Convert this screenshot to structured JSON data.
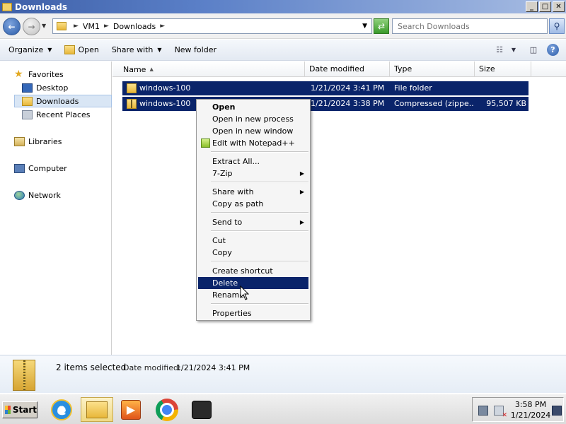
{
  "window": {
    "title": "Downloads",
    "controls": [
      "_",
      "□",
      "✕"
    ]
  },
  "address": {
    "crumbs": [
      "VM1",
      "Downloads"
    ],
    "search_placeholder": "Search Downloads"
  },
  "commandbar": {
    "organize": "Organize",
    "open": "Open",
    "share_with": "Share with",
    "new_folder": "New folder"
  },
  "navpane": {
    "favorites": "Favorites",
    "desktop": "Desktop",
    "downloads": "Downloads",
    "recent": "Recent Places",
    "libraries": "Libraries",
    "computer": "Computer",
    "network": "Network"
  },
  "columns": [
    "Name",
    "Date modified",
    "Type",
    "Size"
  ],
  "files": [
    {
      "name": "windows-100",
      "date": "1/21/2024 3:41 PM",
      "type": "File folder",
      "size": "",
      "icon": "folder-icon"
    },
    {
      "name": "windows-100",
      "date": "1/21/2024 3:38 PM",
      "type": "Compressed (zippe...",
      "size": "95,507 KB",
      "icon": "zip-icon"
    }
  ],
  "context_menu": {
    "open": "Open",
    "open_new_process": "Open in new process",
    "open_new_window": "Open in new window",
    "edit_notepad": "Edit with Notepad++",
    "extract_all": "Extract All...",
    "zip7": "7-Zip",
    "share_with": "Share with",
    "copy_path": "Copy as path",
    "send_to": "Send to",
    "cut": "Cut",
    "copy": "Copy",
    "create_shortcut": "Create shortcut",
    "delete": "Delete",
    "rename": "Rename",
    "properties": "Properties"
  },
  "details": {
    "selected": "2 items selected",
    "date_label": "Date modified:",
    "date_value": "1/21/2024 3:41 PM"
  },
  "taskbar": {
    "start": "Start",
    "time": "3:58 PM",
    "date": "1/21/2024"
  },
  "colors": {
    "selection": "#0a246a",
    "title_gradient_start": "#3e60a8"
  }
}
